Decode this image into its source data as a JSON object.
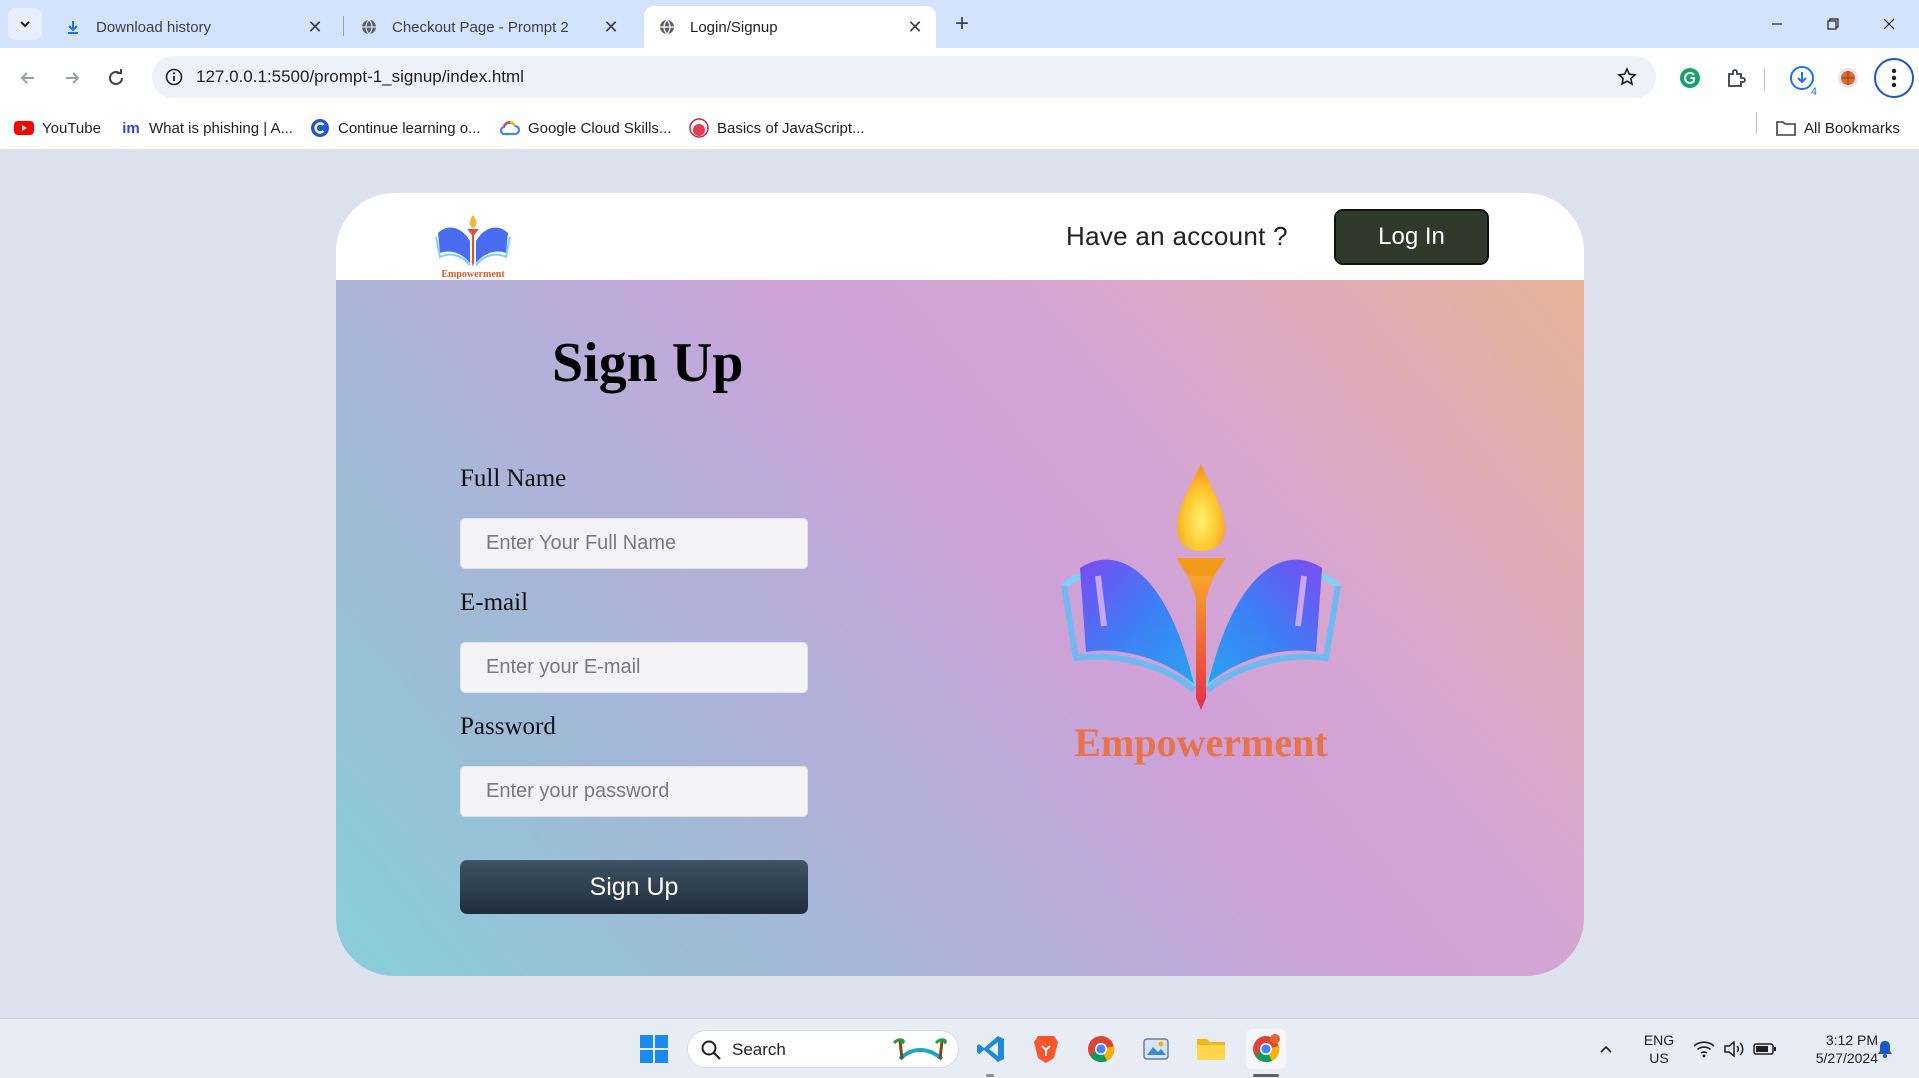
{
  "browser": {
    "tabs": [
      {
        "title": "Download history",
        "icon": "download-icon",
        "active": false
      },
      {
        "title": "Checkout Page - Prompt 2",
        "icon": "globe-icon",
        "active": false
      },
      {
        "title": "Login/Signup",
        "icon": "globe-icon",
        "active": true
      }
    ],
    "url": "127.0.0.1:5500/prompt-1_signup/index.html",
    "download_count": "4",
    "bookmarks": [
      {
        "label": "YouTube",
        "icon": "youtube-icon"
      },
      {
        "label": "What is phishing | A...",
        "icon": "im-icon"
      },
      {
        "label": "Continue learning o...",
        "icon": "c-icon"
      },
      {
        "label": "Google Cloud Skills...",
        "icon": "google-cloud-icon"
      },
      {
        "label": "Basics of JavaScript...",
        "icon": "js-course-icon"
      }
    ],
    "all_bookmarks": "All Bookmarks"
  },
  "page": {
    "header": {
      "logo_text": "Empowerment",
      "have_account": "Have an account ?",
      "login_label": "Log In"
    },
    "form": {
      "title": "Sign Up",
      "fields": [
        {
          "label": "Full Name",
          "placeholder": "Enter Your Full Name"
        },
        {
          "label": "E-mail",
          "placeholder": "Enter your E-mail"
        },
        {
          "label": "Password",
          "placeholder": "Enter your password"
        }
      ],
      "submit_label": "Sign Up"
    },
    "brand": {
      "name": "Empowerment"
    }
  },
  "taskbar": {
    "search_label": "Search",
    "lang": "ENG",
    "region": "US",
    "time": "3:12 PM",
    "date": "5/27/2024"
  },
  "colors": {
    "accent": "#2f3a2a",
    "signup_button": "#2a3b4b",
    "brand_text": "#e8734a"
  }
}
